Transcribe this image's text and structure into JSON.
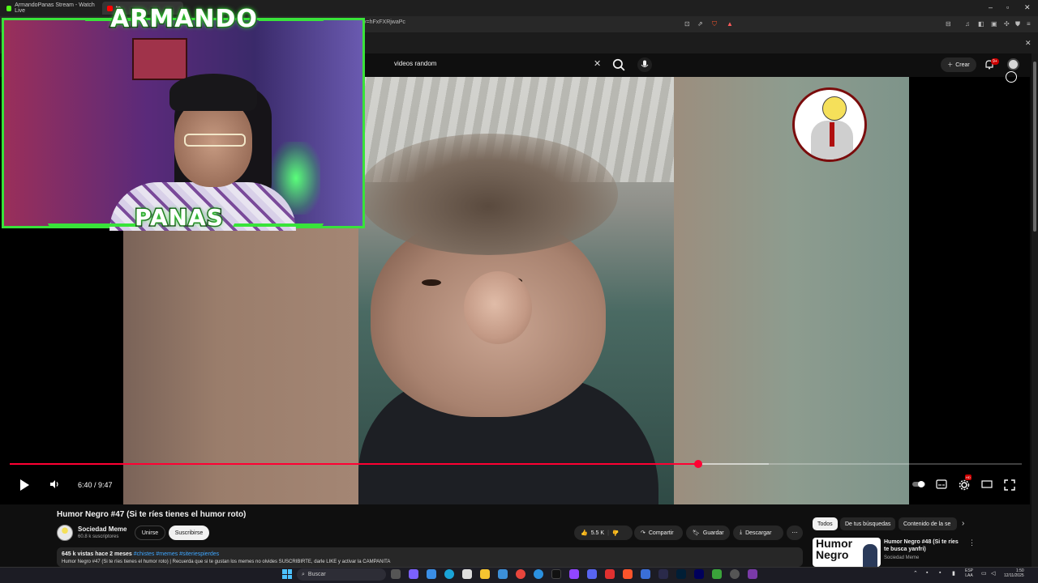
{
  "browser": {
    "tabs": [
      {
        "label": "ArmandoPanas Stream - Watch Live",
        "favicon_color": "#53fc18"
      },
      {
        "label": "te",
        "favicon_color": "#ff0000"
      }
    ],
    "url": "v=hFxFXRjwaPc"
  },
  "youtube": {
    "search_query": "videos random",
    "create_label": "Crear",
    "notification_count": "9+"
  },
  "stream_overlay": {
    "name_top": "ARMANDO",
    "name_bottom": "PANAS",
    "accent_color": "#39e33a"
  },
  "player": {
    "time_display": "6:40 / 9:47",
    "progress_fraction": 0.68,
    "buffer_fraction": 0.75,
    "quality_badge": "HD",
    "progress_color": "#ff0033"
  },
  "video": {
    "title": "Humor Negro #47 (Si te ríes tienes el humor roto)",
    "channel_name": "Sociedad Meme",
    "channel_subs": "60.8 k suscriptores",
    "join_label": "Unirse",
    "subscribe_label": "Suscribirse",
    "likes": "5.5 K",
    "share_label": "Compartir",
    "save_label": "Guardar",
    "download_label": "Descargar",
    "views_date": "645 k vistas  hace 2 meses",
    "tags": "#chistes #memes #siteriespierdes",
    "description_line": "Humor Negro #47 (Si te ríes tienes el humor roto) | Recuerda que si te gustan los memes no olvides SUSCRIBIRTE, darle LIKE y activar la CAMPANITA"
  },
  "sidebar": {
    "chips": [
      "Todos",
      "De tus búsquedas",
      "Contenido de la se"
    ],
    "recommendation": {
      "thumb_text": "Humor Negro",
      "title": "Humor Negro #48 (Si te ríes te busca yanfri)",
      "channel": "Sociedad Meme"
    }
  },
  "taskbar": {
    "search_label": "Buscar",
    "lang": "ESP",
    "lang_sub": "LAA",
    "time": "1:50",
    "date": "12/11/2025"
  }
}
